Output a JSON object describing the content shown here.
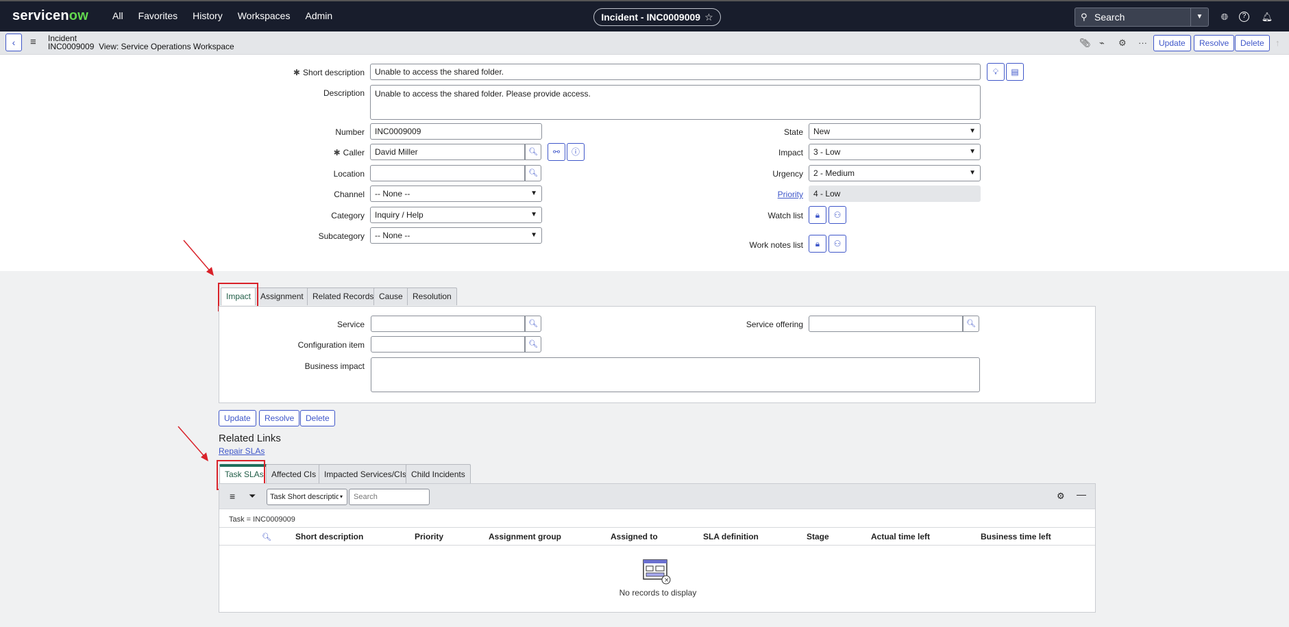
{
  "nav": {
    "logo_text": "servicenow",
    "links": [
      "All",
      "Favorites",
      "History",
      "Workspaces",
      "Admin"
    ],
    "record_pill": "Incident - INC0009009",
    "search_placeholder": "Search"
  },
  "header": {
    "table": "Incident",
    "number": "INC0009009",
    "view": "View: Service Operations Workspace",
    "buttons": {
      "update": "Update",
      "resolve": "Resolve",
      "delete": "Delete"
    }
  },
  "form": {
    "short_description": {
      "label": "Short description",
      "value": "Unable to access the shared folder."
    },
    "description": {
      "label": "Description",
      "value": "Unable to access the shared folder. Please provide access."
    },
    "number": {
      "label": "Number",
      "value": "INC0009009"
    },
    "caller": {
      "label": "Caller",
      "value": "David Miller"
    },
    "location": {
      "label": "Location",
      "value": ""
    },
    "channel": {
      "label": "Channel",
      "value": "-- None --"
    },
    "category": {
      "label": "Category",
      "value": "Inquiry / Help"
    },
    "subcategory": {
      "label": "Subcategory",
      "value": "-- None --"
    },
    "state": {
      "label": "State",
      "value": "New"
    },
    "impact": {
      "label": "Impact",
      "value": "3 - Low"
    },
    "urgency": {
      "label": "Urgency",
      "value": "2 - Medium"
    },
    "priority": {
      "label": "Priority",
      "value": "4 - Low"
    },
    "watch_list": {
      "label": "Watch list"
    },
    "work_notes_list": {
      "label": "Work notes list"
    }
  },
  "section_tabs": [
    "Impact",
    "Assignment",
    "Related Records",
    "Cause",
    "Resolution"
  ],
  "impact_section": {
    "service": "Service",
    "service_offering": "Service offering",
    "configuration_item": "Configuration item",
    "business_impact": "Business impact"
  },
  "bottom_buttons": {
    "update": "Update",
    "resolve": "Resolve",
    "delete": "Delete"
  },
  "related_links": {
    "title": "Related Links",
    "repair_slas": "Repair SLAs"
  },
  "related_tabs": [
    "Task SLAs",
    "Affected CIs",
    "Impacted Services/CIs",
    "Child Incidents"
  ],
  "list": {
    "field_select": "Task Short descriptio",
    "search_placeholder": "Search",
    "breadcrumb": "Task = INC0009009",
    "columns": [
      "Short description",
      "Priority",
      "Assignment group",
      "Assigned to",
      "SLA definition",
      "Stage",
      "Actual time left",
      "Business time left"
    ],
    "empty_text": "No records to display"
  },
  "annotation_color": "#d9222a"
}
